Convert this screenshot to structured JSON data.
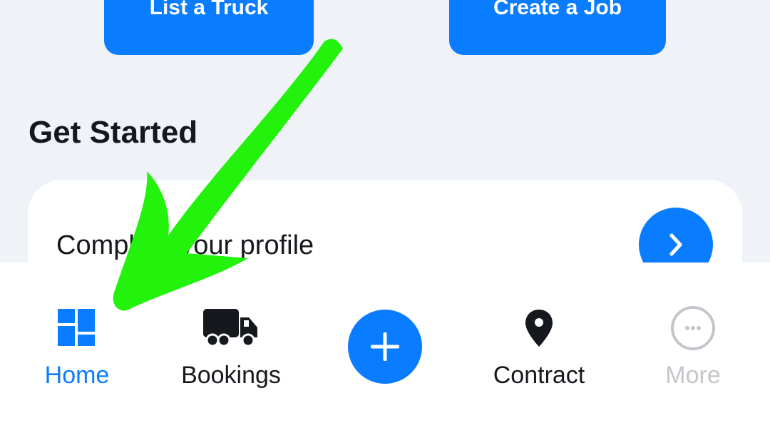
{
  "actions": {
    "list_truck_label": "List a Truck",
    "create_job_label": "Create a Job"
  },
  "get_started": {
    "title": "Get Started",
    "card": {
      "title": "Complete your profile",
      "next_icon": "chevron-right-icon"
    }
  },
  "bottom_nav": {
    "items": [
      {
        "label": "Home",
        "icon": "dashboard-icon",
        "active": true
      },
      {
        "label": "Bookings",
        "icon": "truck-icon"
      },
      {
        "label": "",
        "icon": "plus-icon"
      },
      {
        "label": "Contract",
        "icon": "map-pin-icon"
      },
      {
        "label": "More",
        "icon": "more-dots-icon",
        "disabled": true
      }
    ]
  },
  "annotation": {
    "type": "green-arrow",
    "color": "#22f20c",
    "points_to": "Home"
  },
  "colors": {
    "accent": "#0a7cff",
    "background": "#eff3f8",
    "text": "#15181c",
    "muted": "#c3c6ca"
  }
}
